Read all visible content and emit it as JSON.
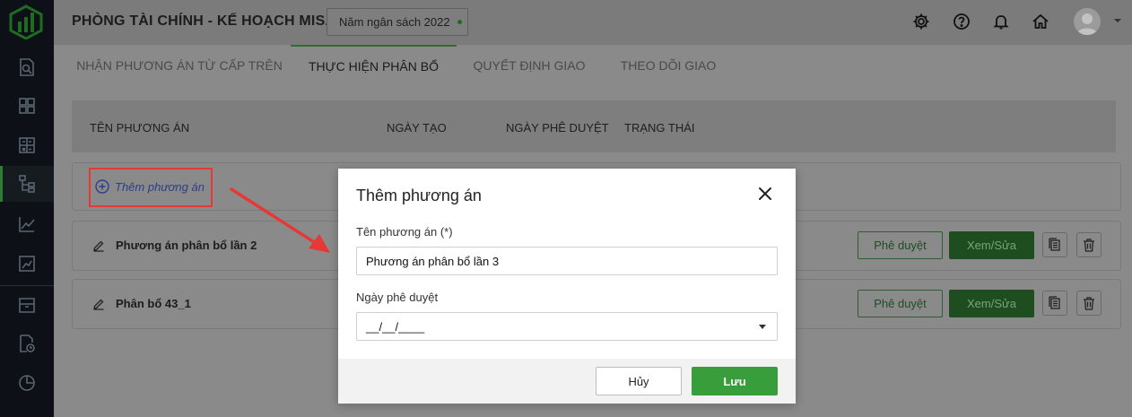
{
  "header": {
    "title": "PHÒNG TÀI CHÍNH - KẾ HOẠCH MISA",
    "budget_year": "Năm ngân sách 2022",
    "icons": [
      "gear-icon",
      "help-icon",
      "bell-icon",
      "home-icon",
      "avatar",
      "chevron-down-icon"
    ]
  },
  "sidebar": {
    "items": [
      {
        "icon": "search-document-icon"
      },
      {
        "icon": "dashboard-icon"
      },
      {
        "icon": "calculator-icon"
      },
      {
        "icon": "hierarchy-icon",
        "active": true
      },
      {
        "icon": "chart-line-icon"
      },
      {
        "icon": "report-icon"
      },
      {
        "icon": "archive-icon"
      },
      {
        "icon": "document-clock-icon"
      },
      {
        "icon": "pie-chart-icon"
      }
    ]
  },
  "tabs": [
    {
      "label": "NHẬN PHƯƠNG ÁN TỪ CẤP TRÊN"
    },
    {
      "label": "THỰC HIỆN PHÂN BỔ",
      "active": true
    },
    {
      "label": "QUYẾT ĐỊNH GIAO"
    },
    {
      "label": "THEO DÕI GIAO"
    }
  ],
  "table": {
    "columns": [
      "TÊN PHƯƠNG ÁN",
      "NGÀY TẠO",
      "NGÀY PHÊ DUYỆT",
      "TRẠNG THÁI"
    ],
    "add_label": "Thêm phương án",
    "rows": [
      {
        "name": "Phương án phân bổ lần 2",
        "approve": "Phê duyệt",
        "view": "Xem/Sửa"
      },
      {
        "name": "Phân bổ 43_1",
        "approve": "Phê duyệt",
        "view": "Xem/Sửa"
      }
    ]
  },
  "modal": {
    "title": "Thêm phương án",
    "name_label": "Tên phương án (*)",
    "name_value": "Phương án phân bổ lần 3",
    "date_label": "Ngày phê duyệt",
    "date_value": "__/__/____",
    "cancel_label": "Hủy",
    "save_label": "Lưu"
  },
  "colors": {
    "accent_green": "#389e3c",
    "highlight_red": "#e53935"
  }
}
